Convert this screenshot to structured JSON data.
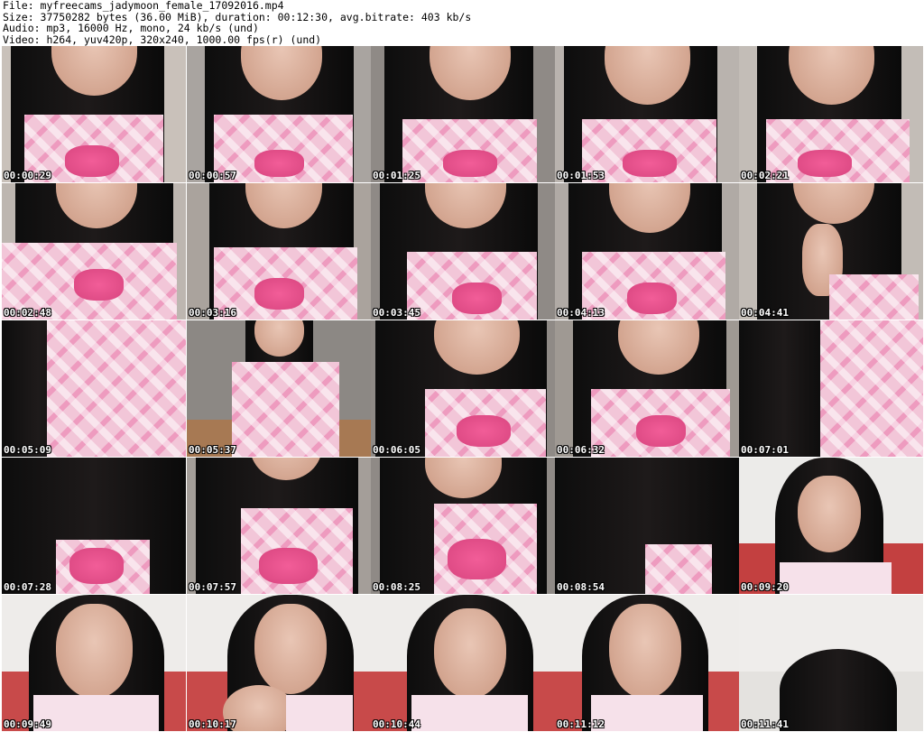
{
  "header": {
    "line1": "File: myfreecams_jadymoon_female_17092016.mp4",
    "line2": "Size: 37750282 bytes (36.00 MiB), duration: 00:12:30, avg.bitrate: 403 kb/s",
    "line3": "Audio: mp3, 16000 Hz, mono, 24 kb/s (und)",
    "line4": "Video: h264, yuv420p, 320x240, 1000.00 fps(r) (und)"
  },
  "thumbnails": [
    "00:00:29",
    "00:00:57",
    "00:01:25",
    "00:01:53",
    "00:02:21",
    "00:02:48",
    "00:03:16",
    "00:03:45",
    "00:04:13",
    "00:04:41",
    "00:05:09",
    "00:05:37",
    "00:06:05",
    "00:06:32",
    "00:07:01",
    "00:07:28",
    "00:07:57",
    "00:08:25",
    "00:08:54",
    "00:09:20",
    "00:09:49",
    "00:10:17",
    "00:10:44",
    "00:11:12",
    "00:11:41"
  ],
  "colors": {
    "background": "#ffffff",
    "timestamp": "#ffffff",
    "timestamp_outline": "#000000"
  }
}
